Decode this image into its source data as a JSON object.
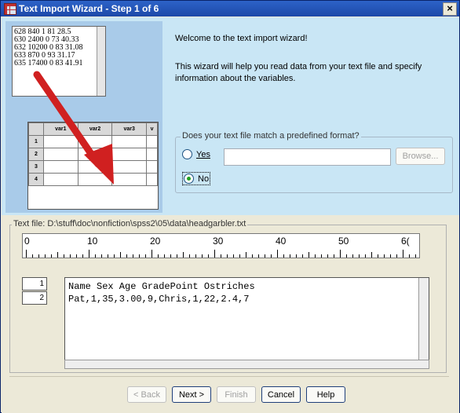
{
  "window": {
    "title": "Text Import Wizard - Step 1 of 6",
    "close_label": "×"
  },
  "illustration": {
    "sample_lines": [
      "628 840 1 81 28.5",
      "630 2400 0 73 40.33",
      "632 10200 0 83 31.08",
      "633 870 0 93 31.17",
      "635 17400 0 83 41.91"
    ],
    "grid_columns": [
      "var1",
      "var2",
      "var3",
      "v"
    ],
    "grid_rows": [
      "1",
      "2",
      "3",
      "4"
    ]
  },
  "intro": {
    "welcome": "Welcome to the text import wizard!",
    "description": "This wizard will help you read data from your text file and specify information about the variables."
  },
  "format_group": {
    "legend": "Does your text file match a predefined format?",
    "yes_label": "Yes",
    "no_label": "No",
    "selected": "No",
    "path_value": "",
    "browse_label": "Browse..."
  },
  "text_file": {
    "label": "Text file:  D:\\stuff\\doc\\nonfiction\\spss2\\05\\data\\headgarbler.txt",
    "ruler_labels": [
      "0",
      "10",
      "20",
      "30",
      "40",
      "50",
      "6("
    ],
    "row_numbers": [
      "1",
      "2"
    ],
    "lines": [
      "Name Sex Age GradePoint Ostriches",
      "Pat,1,35,3.00,9,Chris,1,22,2.4,7"
    ]
  },
  "buttons": {
    "back": "< Back",
    "next": "Next >",
    "finish": "Finish",
    "cancel": "Cancel",
    "help": "Help"
  }
}
